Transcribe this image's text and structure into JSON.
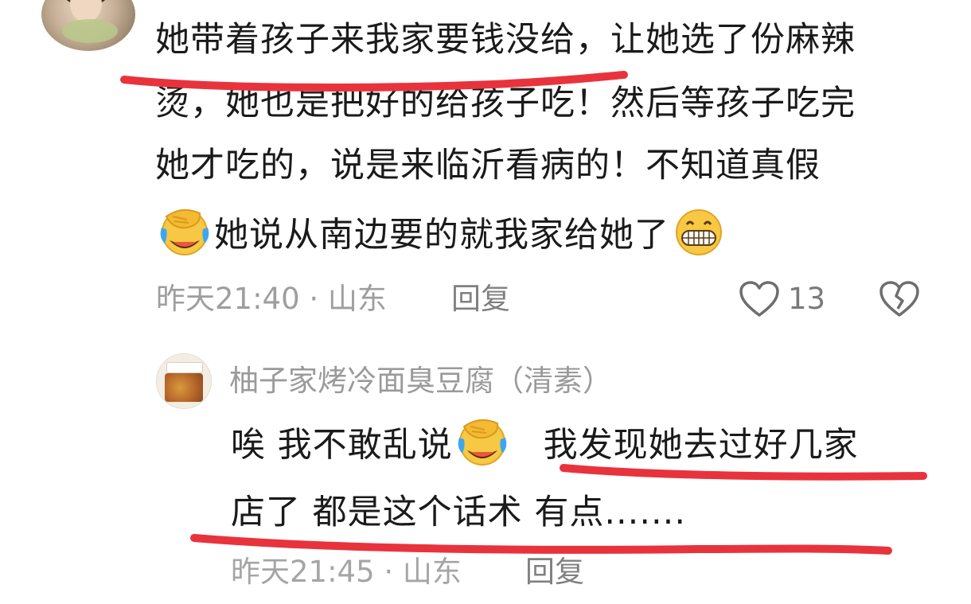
{
  "comment": {
    "lines": [
      "她带着孩子来我家要钱没给，让她选了份麻辣",
      "烫，她也是把好的给孩子吃！然后等孩子吃完",
      "她才吃的，说是来临沂看病的！不知道真假"
    ],
    "line4_text": "她说从南边要的就我家给她了",
    "emoji_first": "facepalm-laugh-emoji",
    "emoji_last": "grin-emoji",
    "time": "昨天21:40 · 山东",
    "reply_label": "回复",
    "like_count": "13"
  },
  "reply": {
    "username": "柚子家烤冷面臭豆腐（清素）",
    "line1_a": "唉  我不敢乱说",
    "line1_b": "我发现她去过好几家",
    "line2": "店了   都是这个话术      有点.......",
    "emoji": "facepalm-laugh-emoji",
    "time": "昨天21:45 · 山东",
    "reply_label": "回复"
  },
  "colors": {
    "underline": "#e8333d",
    "meta_text": "#9e9e9e",
    "body_text": "#1a1a1a",
    "emoji_yellow": "#f7c843"
  }
}
